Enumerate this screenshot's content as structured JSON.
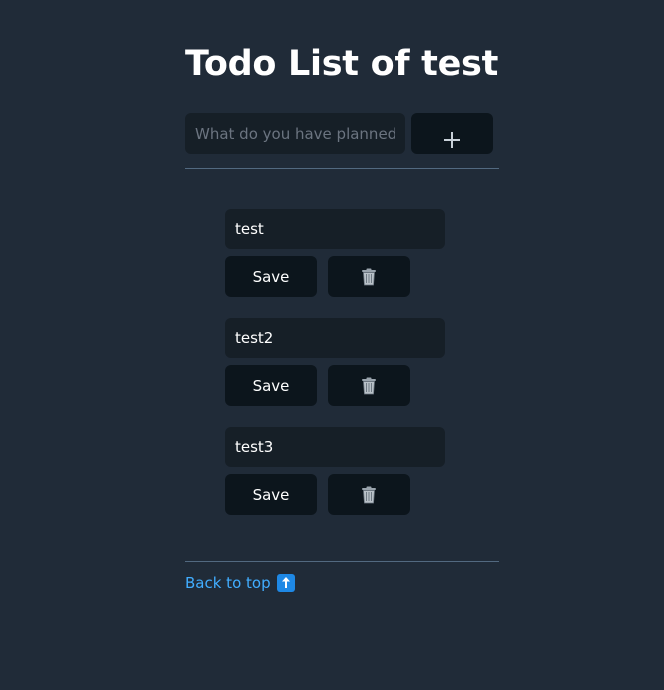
{
  "page": {
    "title": "Todo List of test"
  },
  "new_todo": {
    "placeholder": "What do you have planned?",
    "add_icon": "plus-icon"
  },
  "todos": [
    {
      "text": "test",
      "save_label": "Save",
      "delete_icon": "trash-icon"
    },
    {
      "text": "test2",
      "save_label": "Save",
      "delete_icon": "trash-icon"
    },
    {
      "text": "test3",
      "save_label": "Save",
      "delete_icon": "trash-icon"
    }
  ],
  "footer": {
    "back_to_top_label": "Back to top",
    "back_to_top_icon": "up-arrow-icon"
  },
  "colors": {
    "background": "#202b38",
    "input_background": "#161f27",
    "button_background": "#0c151c",
    "link": "#41adff",
    "divider": "#526980"
  }
}
